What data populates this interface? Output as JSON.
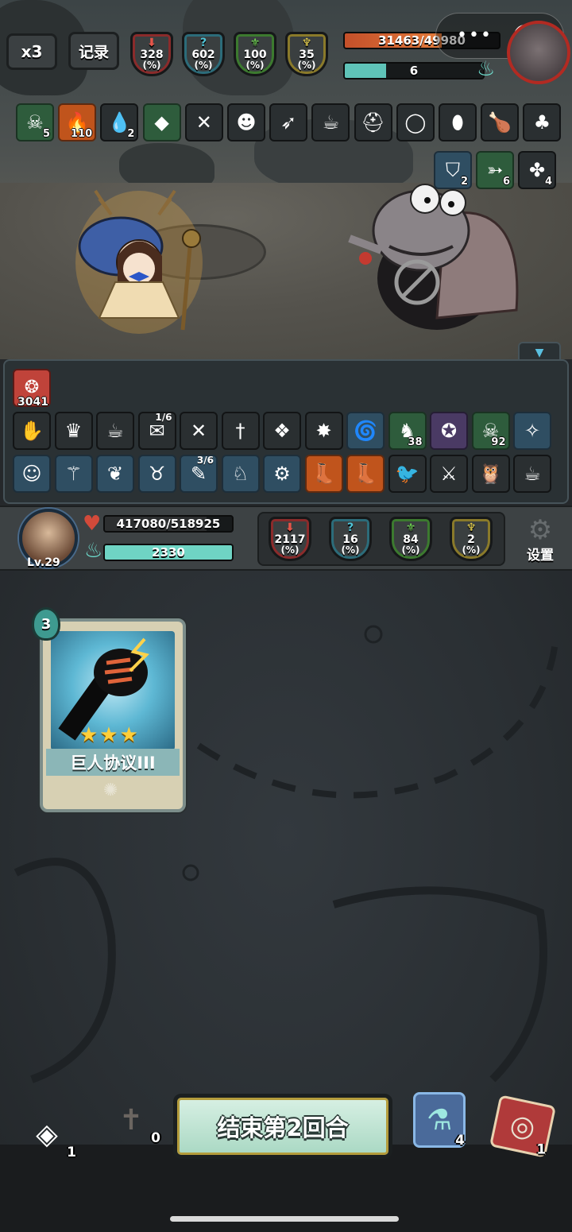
{
  "top": {
    "speed_label": "x3",
    "record_label": "记录",
    "enemy_stats": [
      {
        "value": "328",
        "unit": "(%)",
        "color": "red",
        "icon": "down-arrow-icon"
      },
      {
        "value": "602",
        "unit": "(%)",
        "color": "blue",
        "icon": "question-icon"
      },
      {
        "value": "100",
        "unit": "(%)",
        "color": "green",
        "icon": "fork-icon"
      },
      {
        "value": "35",
        "unit": "(%)",
        "color": "yellow",
        "icon": "trident-icon"
      }
    ],
    "enemy_hp": "31463/49980",
    "enemy_hp_fraction": 0.63,
    "enemy_energy": "6",
    "enemy_energy_fraction": 0.3,
    "capsule_dots": "•••"
  },
  "enemy_buffs": [
    {
      "icon": "skull-icon",
      "count": "5"
    },
    {
      "icon": "flame-icon",
      "count": "110"
    },
    {
      "icon": "blood-drop-icon",
      "count": "2"
    },
    {
      "icon": "gem-icon",
      "count": ""
    },
    {
      "icon": "crossbow-icon",
      "count": ""
    },
    {
      "icon": "demon-icon",
      "count": ""
    },
    {
      "icon": "horn-icon",
      "count": ""
    },
    {
      "icon": "teacup-icon",
      "count": ""
    },
    {
      "icon": "helmet-icon",
      "count": ""
    },
    {
      "icon": "ring-icon",
      "count": ""
    },
    {
      "icon": "egg-icon",
      "count": ""
    },
    {
      "icon": "drumstick-icon",
      "count": ""
    },
    {
      "icon": "mushroom-icon",
      "count": ""
    }
  ],
  "enemy_intents": [
    {
      "icon": "shield-icon",
      "count": "2"
    },
    {
      "icon": "wing-icon",
      "count": "6"
    },
    {
      "icon": "clover-icon",
      "count": "4"
    }
  ],
  "player_panel": {
    "block_value": "3041",
    "row1": [
      {
        "icon": "glove-icon",
        "count": "",
        "top": ""
      },
      {
        "icon": "crown-icon",
        "count": "",
        "top": ""
      },
      {
        "icon": "teacup-icon",
        "count": "",
        "top": ""
      },
      {
        "icon": "scroll-icon",
        "count": "",
        "top": "1/6"
      },
      {
        "icon": "crossbow-icon",
        "count": "",
        "top": ""
      },
      {
        "icon": "dagger-icon",
        "count": "",
        "top": ""
      },
      {
        "icon": "crystal-icon",
        "count": "",
        "top": ""
      },
      {
        "icon": "firework-icon",
        "count": "",
        "top": ""
      },
      {
        "icon": "whirlwind-icon",
        "count": "",
        "top": ""
      },
      {
        "icon": "dragon-icon",
        "count": "38",
        "top": ""
      },
      {
        "icon": "pentagram-icon",
        "count": "",
        "top": ""
      },
      {
        "icon": "skull-icon",
        "count": "92",
        "top": ""
      },
      {
        "icon": "rune-icon",
        "count": "",
        "top": ""
      }
    ],
    "row2": [
      {
        "icon": "face-icon",
        "count": "",
        "top": "",
        "color": "blue"
      },
      {
        "icon": "staff-icon",
        "count": "",
        "top": "",
        "color": "blue"
      },
      {
        "icon": "leaf-icon",
        "count": "",
        "top": "",
        "color": "blue"
      },
      {
        "icon": "horned-icon",
        "count": "",
        "top": "",
        "color": "blue"
      },
      {
        "icon": "feather-icon",
        "count": "",
        "top": "3/6",
        "color": "blue"
      },
      {
        "icon": "beast-icon",
        "count": "",
        "top": "",
        "color": "blue"
      },
      {
        "icon": "gear-icon",
        "count": "",
        "top": "",
        "color": "blue"
      },
      {
        "icon": "boot-icon",
        "count": "",
        "top": "",
        "color": "orange"
      },
      {
        "icon": "boot-icon",
        "count": "",
        "top": "",
        "color": "orange"
      },
      {
        "icon": "bird-icon",
        "count": "",
        "top": "",
        "color": ""
      },
      {
        "icon": "knight-helmet-icon",
        "count": "",
        "top": "",
        "color": ""
      },
      {
        "icon": "owl-icon",
        "count": "",
        "top": "",
        "color": ""
      },
      {
        "icon": "teacup-icon",
        "count": "",
        "top": "",
        "color": ""
      }
    ]
  },
  "player": {
    "level": "Lv.29",
    "hp": "417080/518925",
    "hp_fraction": 0.8,
    "energy": "2330",
    "energy_fraction": 1.0,
    "stats": [
      {
        "value": "2117",
        "unit": "(%)",
        "color": "red",
        "icon": "down-arrow-icon"
      },
      {
        "value": "16",
        "unit": "(%)",
        "color": "blue",
        "icon": "question-icon"
      },
      {
        "value": "84",
        "unit": "(%)",
        "color": "green",
        "icon": "fork-icon"
      },
      {
        "value": "2",
        "unit": "(%)",
        "color": "yellow",
        "icon": "trident-icon"
      }
    ],
    "settings_label": "设置"
  },
  "hand": {
    "card_cost": "3",
    "card_name": "巨人协议III",
    "card_stars": "★★★",
    "card_icon": "fist-icon",
    "effect_icon": "burst-icon"
  },
  "bottom": {
    "draw_pile_count": "1",
    "grave_count": "0",
    "end_turn_label": "结束第2回合",
    "potion_count": "4",
    "discard_count": "1"
  }
}
